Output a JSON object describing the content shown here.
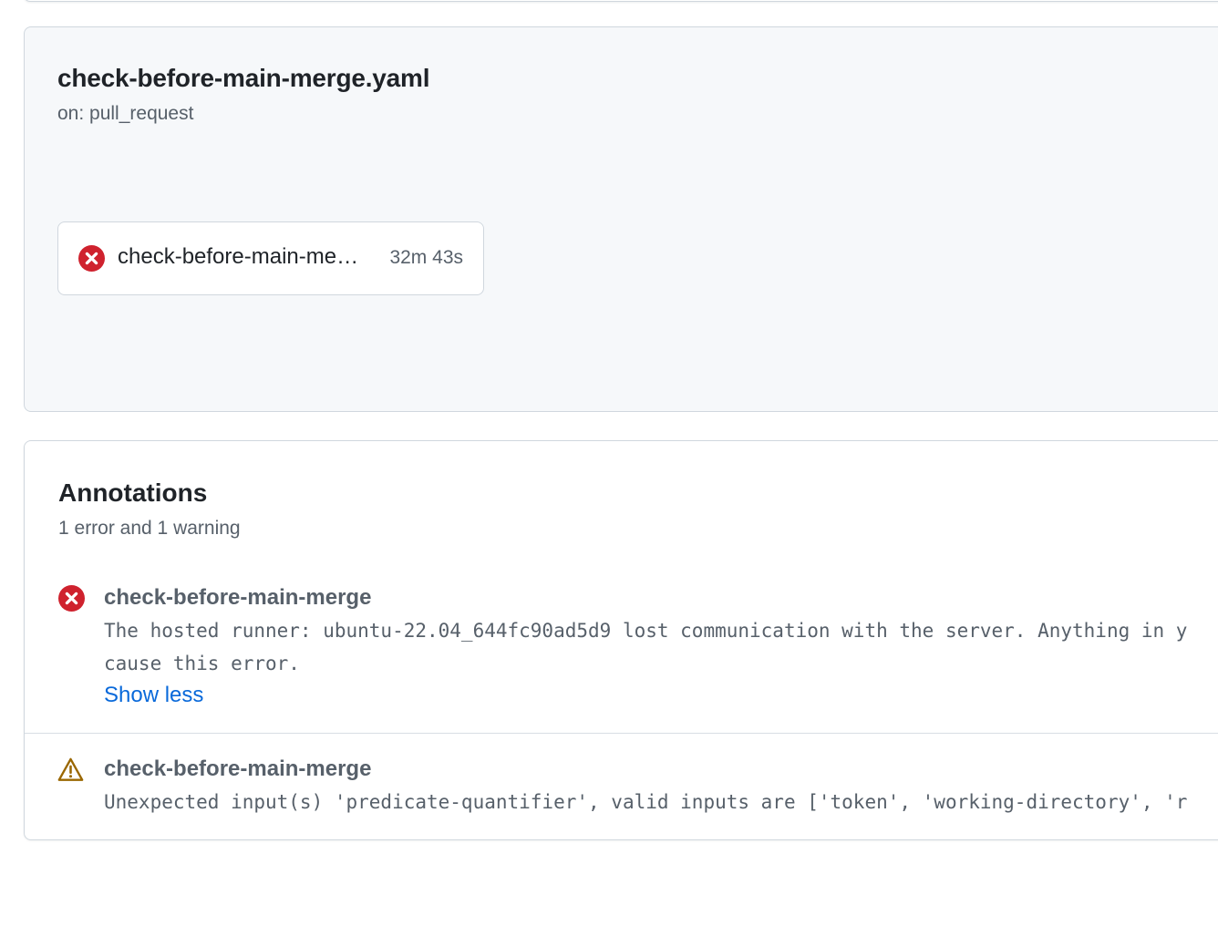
{
  "workflow": {
    "title": "check-before-main-merge.yaml",
    "trigger": "on: pull_request",
    "job": {
      "name": "check-before-main-merge",
      "duration": "32m 43s",
      "status": "failure",
      "icon": "x-circle-fill-icon"
    }
  },
  "annotations": {
    "title": "Annotations",
    "summary": "1 error and 1 warning",
    "items": [
      {
        "level": "error",
        "icon": "x-circle-fill-icon",
        "name": "check-before-main-merge",
        "message_line1": "The hosted runner: ubuntu-22.04_644fc90ad5d9 lost communication with the server. Anything in y",
        "message_line2": "cause this error.",
        "toggle_label": "Show less"
      },
      {
        "level": "warning",
        "icon": "alert-triangle-icon",
        "name": "check-before-main-merge",
        "message_line1": "Unexpected input(s) 'predicate-quantifier', valid inputs are ['token', 'working-directory', 'r"
      }
    ]
  },
  "colors": {
    "error": "#cf222e",
    "warning": "#9a6700",
    "link": "#0969da",
    "muted": "#57606a",
    "text": "#1f2328"
  }
}
